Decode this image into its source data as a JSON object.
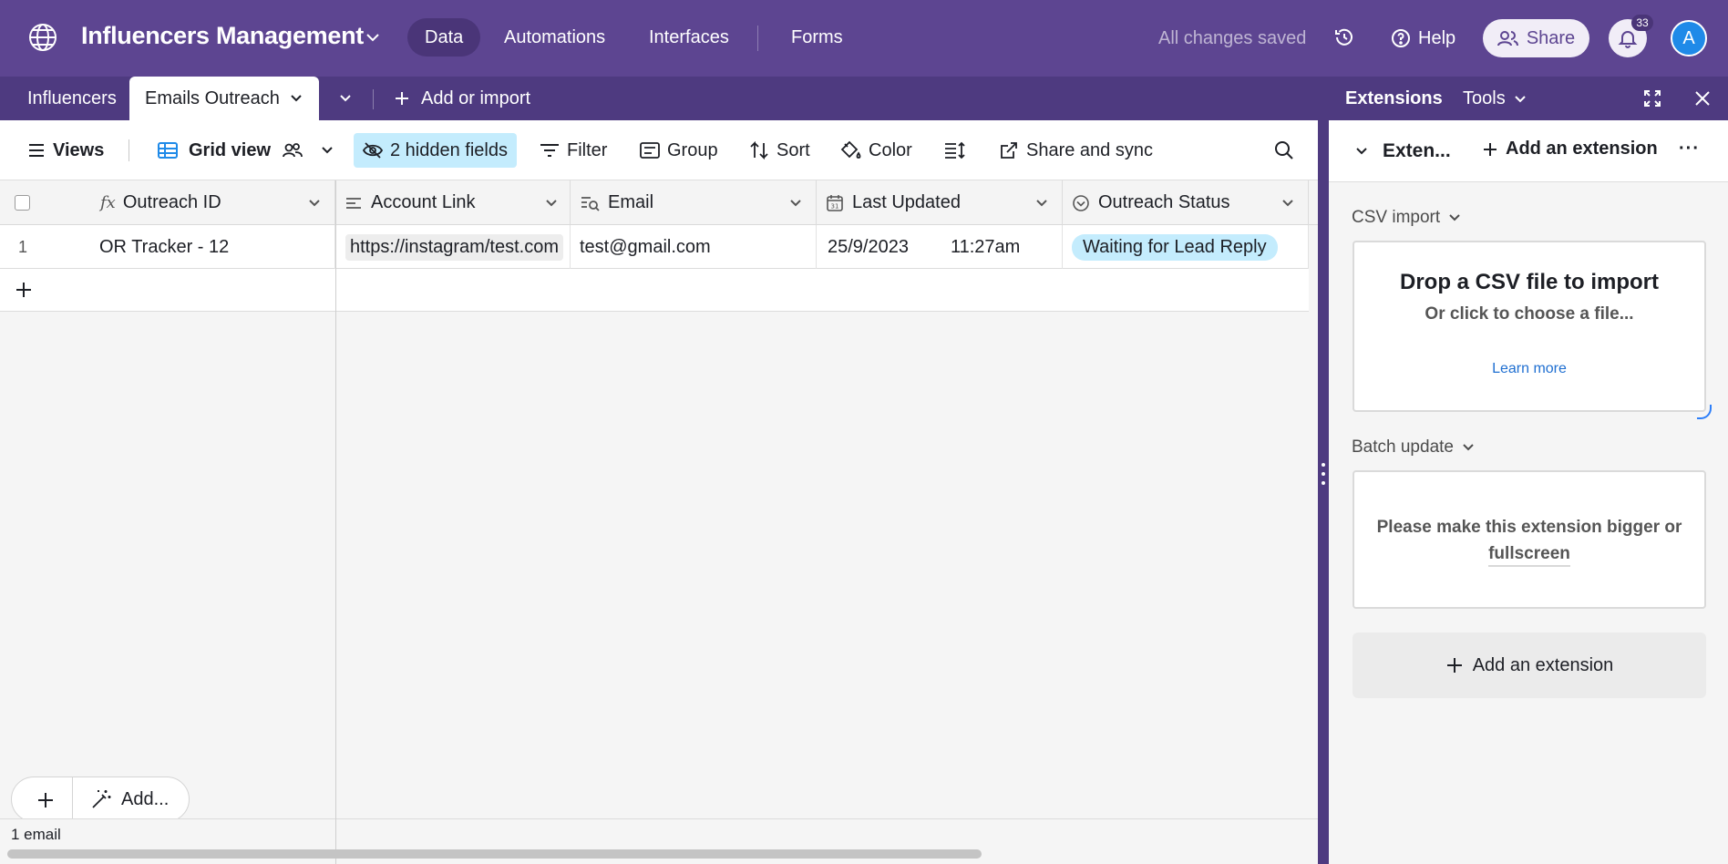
{
  "header": {
    "base_title": "Influencers Management",
    "nav": [
      "Data",
      "Automations",
      "Interfaces",
      "Forms"
    ],
    "active_nav": "Data",
    "saved_status": "All changes saved",
    "help_label": "Help",
    "share_label": "Share",
    "notification_count": "33",
    "avatar_initial": "A"
  },
  "tabs": {
    "items": [
      "Influencers",
      "Emails Outreach"
    ],
    "active": "Emails Outreach",
    "add_label": "Add or import"
  },
  "viewbar": {
    "views_label": "Views",
    "view_name": "Grid view",
    "hidden_fields_label": "2 hidden fields",
    "filter_label": "Filter",
    "group_label": "Group",
    "sort_label": "Sort",
    "color_label": "Color",
    "share_sync_label": "Share and sync"
  },
  "grid": {
    "columns": [
      "Outreach ID",
      "Account Link",
      "Email",
      "Last Updated",
      "Outreach Status"
    ],
    "rows": [
      {
        "row_number": "1",
        "outreach_id": "OR Tracker - 12",
        "account_link": "https://instagram/test.com",
        "email": "test@gmail.com",
        "last_updated_date": "25/9/2023",
        "last_updated_time": "11:27am",
        "outreach_status": "Waiting for Lead Reply"
      }
    ],
    "footer_count": "1 email",
    "add_field_label": "Add..."
  },
  "extensions": {
    "tabs": [
      "Extensions",
      "Tools"
    ],
    "panel_title": "Exten...",
    "add_extension_label": "Add an extension",
    "csv": {
      "section_title": "CSV import",
      "drop_title": "Drop a CSV file to import",
      "drop_sub": "Or click to choose a file...",
      "learn_more": "Learn more"
    },
    "batch": {
      "section_title": "Batch update",
      "message_line1": "Please make this extension bigger or",
      "message_line2": "fullscreen"
    },
    "add_extension_big_label": "Add an extension"
  },
  "colors": {
    "header_bg": "#5d4591",
    "tabbar_bg": "#4e3a80",
    "highlight": "#c4ecfd",
    "accent_blue": "#1f8ae8"
  }
}
